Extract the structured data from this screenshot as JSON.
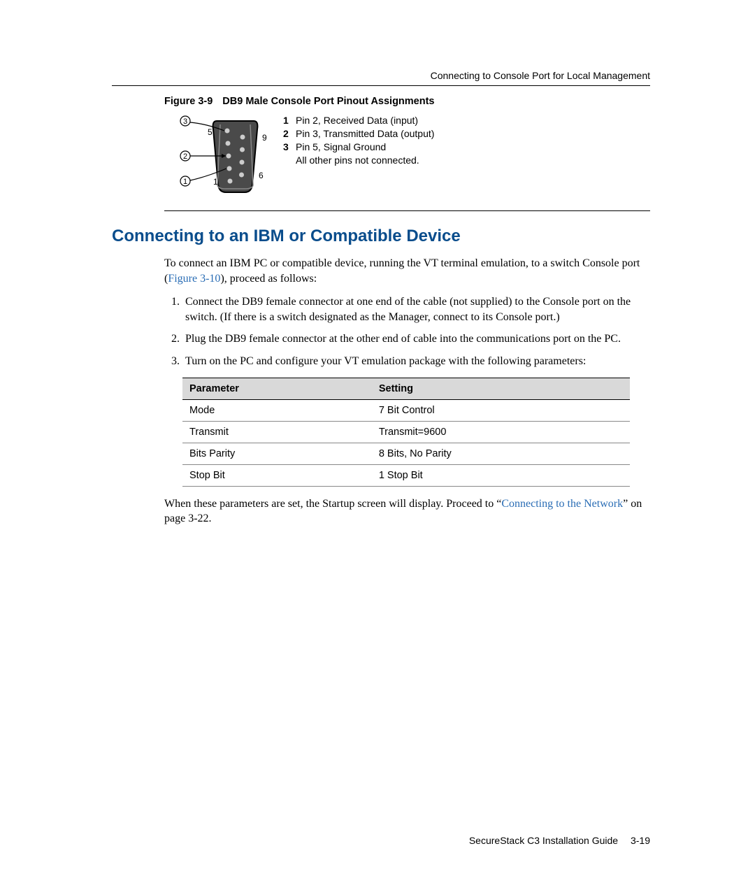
{
  "header": {
    "right_text": "Connecting to Console Port for Local Management"
  },
  "figure": {
    "label": "Figure 3-9",
    "title": "DB9 Male Console Port Pinout Assignments",
    "pin_labels": {
      "one": "1",
      "five": "5",
      "six": "6",
      "nine": "9"
    },
    "callouts": {
      "c1": "1",
      "c2": "2",
      "c3": "3"
    },
    "legend": [
      {
        "num": "1",
        "text": "Pin 2, Received Data (input)"
      },
      {
        "num": "2",
        "text": "Pin 3, Transmitted Data (output)"
      },
      {
        "num": "3",
        "text": "Pin 5, Signal Ground"
      },
      {
        "num": "",
        "text": "All other pins not connected."
      }
    ]
  },
  "section": {
    "heading": "Connecting to an IBM or Compatible Device",
    "intro_pre": "To connect an IBM PC or compatible device, running the VT terminal emulation, to a switch Console port (",
    "intro_link": "Figure 3-10",
    "intro_post": "), proceed as follows:",
    "steps": [
      "Connect the DB9 female connector at one end of the cable (not supplied) to the Console port on the switch. (If there is a switch designated as the Manager, connect to its Console port.)",
      "Plug the DB9 female connector at the other end of cable into the communications port on the PC.",
      "Turn on the PC and configure your VT emulation package with the following parameters:"
    ],
    "table": {
      "headers": [
        "Parameter",
        "Setting"
      ],
      "rows": [
        [
          "Mode",
          "7 Bit Control"
        ],
        [
          "Transmit",
          "Transmit=9600"
        ],
        [
          "Bits Parity",
          "8 Bits, No Parity"
        ],
        [
          "Stop Bit",
          "1 Stop Bit"
        ]
      ]
    },
    "closing_pre": "When these parameters are set, the Startup screen will display. Proceed to “",
    "closing_link": "Connecting to the Network",
    "closing_post": "” on page 3-22."
  },
  "footer": {
    "guide": "SecureStack C3 Installation Guide",
    "page": "3-19"
  }
}
